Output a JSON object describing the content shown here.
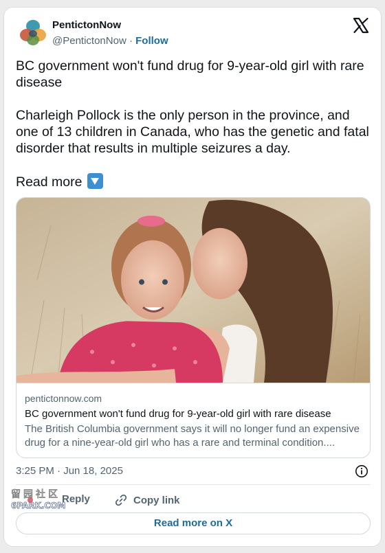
{
  "post": {
    "author_name": "PentictonNow",
    "author_handle": "@PentictonNow",
    "separator": "·",
    "follow_label": "Follow",
    "text_line1": "BC government won't fund drug for 9-year-old girl with rare disease",
    "text_para2": "Charleigh Pollock is the only person in the province, and one of 13 children in Canada, who has the genetic and fatal disorder that results in multiple seizures a day.",
    "text_read_more": "Read more"
  },
  "link_card": {
    "domain": "pentictonnow.com",
    "title": "BC government won't fund drug for 9-year-old girl with rare disease",
    "description": "The British Columbia government says it will no longer fund an expensive drug for a nine-year-old girl who has a rare and terminal condition...."
  },
  "meta": {
    "timestamp": "3:25 PM · Jun 18, 2025"
  },
  "actions": {
    "reply_label": "Reply",
    "copy_link_label": "Copy link",
    "read_more_on_x_label": "Read more on X"
  },
  "watermark": {
    "text_top": "留园社区",
    "text_bottom": "6PARK.COM"
  },
  "colors": {
    "link_blue": "#1d6b9b",
    "secondary_text": "#536471",
    "border": "#cfd9de"
  },
  "icons": [
    "pentictonnow-logo-icon",
    "x-logo-icon",
    "down-arrow-emoji-icon",
    "info-icon",
    "reply-icon",
    "link-icon"
  ]
}
